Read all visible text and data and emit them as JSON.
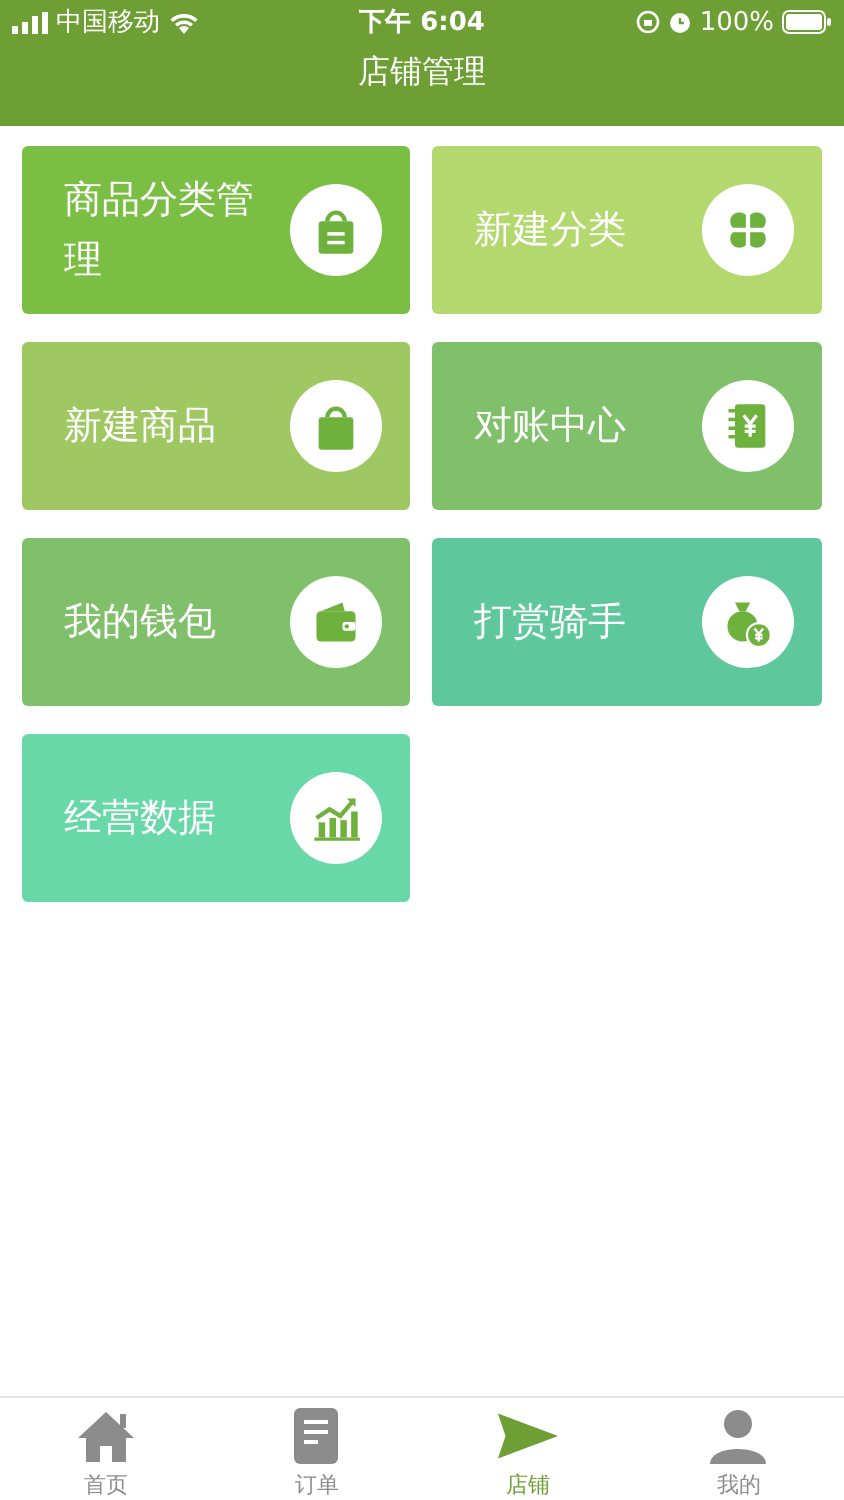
{
  "status_bar": {
    "carrier": "中国移动",
    "time": "下午 6:04",
    "battery": "100%"
  },
  "header": {
    "title": "店铺管理"
  },
  "tiles": [
    {
      "label": "商品分类管理",
      "kind": "category-bag",
      "color": "#7abf44"
    },
    {
      "label": "新建分类",
      "kind": "clover",
      "color": "#b3d86d"
    },
    {
      "label": "新建商品",
      "kind": "bag",
      "color": "#9fc863"
    },
    {
      "label": "对账中心",
      "kind": "ledger",
      "color": "#80c06a"
    },
    {
      "label": "我的钱包",
      "kind": "wallet",
      "color": "#80c06a"
    },
    {
      "label": "打赏骑手",
      "kind": "money-bag",
      "color": "#5ec79b"
    },
    {
      "label": "经营数据",
      "kind": "chart",
      "color": "#68d8a8"
    }
  ],
  "tab_bar": [
    {
      "label": "首页",
      "kind": "home",
      "selected": false
    },
    {
      "label": "订单",
      "kind": "document",
      "selected": false
    },
    {
      "label": "店铺",
      "kind": "send",
      "selected": true
    },
    {
      "label": "我的",
      "kind": "person",
      "selected": false
    }
  ]
}
